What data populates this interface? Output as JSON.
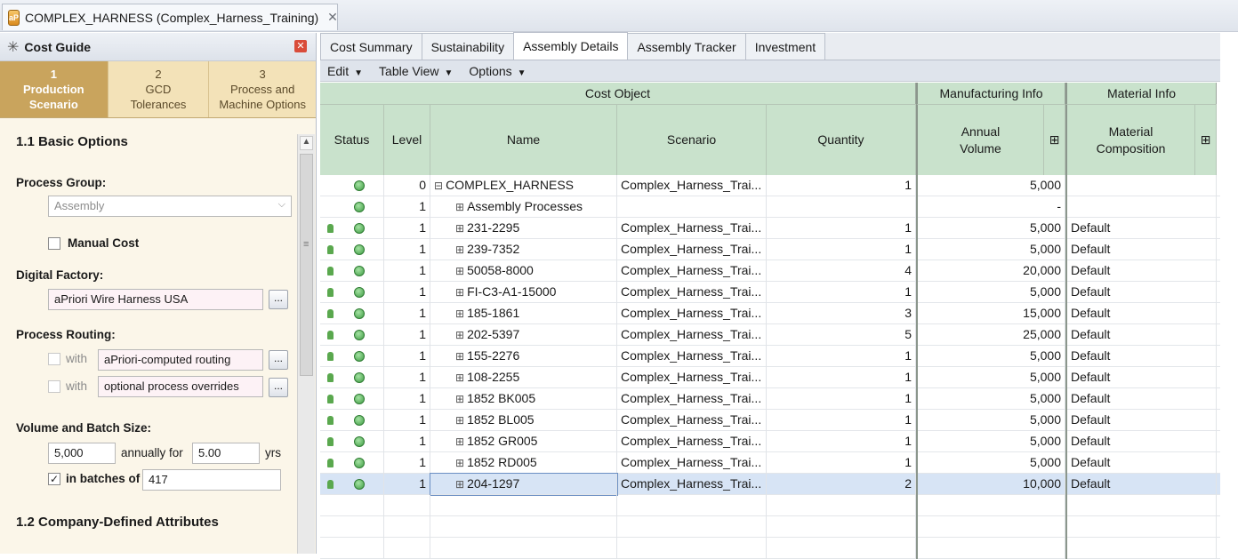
{
  "window": {
    "doc_tab_title": "COMPLEX_HARNESS (Complex_Harness_Training)",
    "app_icon_text": "aP"
  },
  "cost_guide": {
    "title": "Cost Guide",
    "steps": [
      {
        "num": "1",
        "line1": "Production",
        "line2": "Scenario"
      },
      {
        "num": "2",
        "line1": "GCD",
        "line2": "Tolerances"
      },
      {
        "num": "3",
        "line1": "Process and",
        "line2": "Machine Options"
      }
    ],
    "section1": "1.1 Basic Options",
    "process_group_label": "Process Group:",
    "process_group_value": "Assembly",
    "manual_cost_label": "Manual Cost",
    "digital_factory_label": "Digital Factory:",
    "digital_factory_value": "aPriori Wire Harness USA",
    "process_routing_label": "Process Routing:",
    "with_label": "with",
    "routing_value": "aPriori-computed routing",
    "overrides_value": "optional process overrides",
    "dots": "...",
    "volume_label": "Volume and Batch Size:",
    "annual_volume": "5,000",
    "annually_for": "annually for",
    "years_value": "5.00",
    "yrs": "yrs",
    "in_batches_of": "in batches of",
    "batch_value": "417",
    "section2": "1.2 Company-Defined Attributes"
  },
  "tabs": [
    "Cost Summary",
    "Sustainability",
    "Assembly Details",
    "Assembly Tracker",
    "Investment"
  ],
  "toolbar": [
    "Edit",
    "Table View",
    "Options"
  ],
  "table": {
    "groups": {
      "cost_object": "Cost Object",
      "manufacturing": "Manufacturing Info",
      "material": "Material Info"
    },
    "headers": {
      "status": "Status",
      "level": "Level",
      "name": "Name",
      "scenario": "Scenario",
      "quantity": "Quantity",
      "annual_volume_1": "Annual",
      "annual_volume_2": "Volume",
      "material_1": "Material",
      "material_2": "Composition",
      "expand": "⊞"
    },
    "rows": [
      {
        "lock": false,
        "level": "0",
        "name": "COMPLEX_HARNESS",
        "root": true,
        "scenario": "Complex_Harness_Trai...",
        "quantity": "1",
        "volume": "5,000",
        "material": ""
      },
      {
        "lock": false,
        "level": "1",
        "name": "Assembly Processes",
        "scenario": "",
        "quantity": "",
        "volume": "-",
        "material": ""
      },
      {
        "lock": true,
        "level": "1",
        "name": "231-2295",
        "scenario": "Complex_Harness_Trai...",
        "quantity": "1",
        "volume": "5,000",
        "material": "Default"
      },
      {
        "lock": true,
        "level": "1",
        "name": "239-7352",
        "scenario": "Complex_Harness_Trai...",
        "quantity": "1",
        "volume": "5,000",
        "material": "Default"
      },
      {
        "lock": true,
        "level": "1",
        "name": "50058-8000",
        "scenario": "Complex_Harness_Trai...",
        "quantity": "4",
        "volume": "20,000",
        "material": "Default"
      },
      {
        "lock": true,
        "level": "1",
        "name": "FI-C3-A1-15000",
        "scenario": "Complex_Harness_Trai...",
        "quantity": "1",
        "volume": "5,000",
        "material": "Default"
      },
      {
        "lock": true,
        "level": "1",
        "name": "185-1861",
        "scenario": "Complex_Harness_Trai...",
        "quantity": "3",
        "volume": "15,000",
        "material": "Default"
      },
      {
        "lock": true,
        "level": "1",
        "name": "202-5397",
        "scenario": "Complex_Harness_Trai...",
        "quantity": "5",
        "volume": "25,000",
        "material": "Default"
      },
      {
        "lock": true,
        "level": "1",
        "name": "155-2276",
        "scenario": "Complex_Harness_Trai...",
        "quantity": "1",
        "volume": "5,000",
        "material": "Default"
      },
      {
        "lock": true,
        "level": "1",
        "name": "108-2255",
        "scenario": "Complex_Harness_Trai...",
        "quantity": "1",
        "volume": "5,000",
        "material": "Default"
      },
      {
        "lock": true,
        "level": "1",
        "name": "1852 BK005",
        "scenario": "Complex_Harness_Trai...",
        "quantity": "1",
        "volume": "5,000",
        "material": "Default"
      },
      {
        "lock": true,
        "level": "1",
        "name": "1852 BL005",
        "scenario": "Complex_Harness_Trai...",
        "quantity": "1",
        "volume": "5,000",
        "material": "Default"
      },
      {
        "lock": true,
        "level": "1",
        "name": "1852 GR005",
        "scenario": "Complex_Harness_Trai...",
        "quantity": "1",
        "volume": "5,000",
        "material": "Default"
      },
      {
        "lock": true,
        "level": "1",
        "name": "1852 RD005",
        "scenario": "Complex_Harness_Trai...",
        "quantity": "1",
        "volume": "5,000",
        "material": "Default"
      },
      {
        "lock": true,
        "level": "1",
        "name": "204-1297",
        "scenario": "Complex_Harness_Trai...",
        "quantity": "2",
        "volume": "10,000",
        "material": "Default",
        "selected": true
      }
    ]
  }
}
